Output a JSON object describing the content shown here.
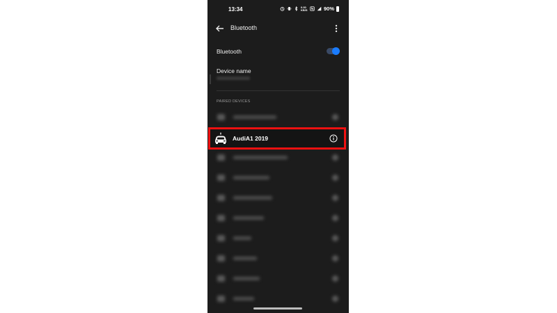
{
  "status_bar": {
    "time": "13:34",
    "data_speed": "0.00 KB/S",
    "battery_percent": "90%"
  },
  "app_bar": {
    "title": "Bluetooth"
  },
  "bluetooth_toggle": {
    "label": "Bluetooth",
    "enabled": true
  },
  "device_name": {
    "label": "Device name"
  },
  "paired_devices": {
    "header": "PAIRED DEVICES",
    "highlighted_device": "AudiA1 2019"
  },
  "colors": {
    "accent": "#1a7cff",
    "highlight_border": "#ee1111",
    "background": "#1c1c1c"
  }
}
